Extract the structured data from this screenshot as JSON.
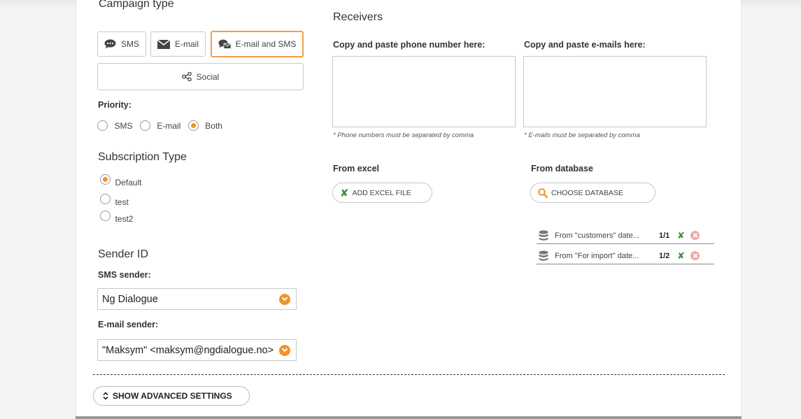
{
  "campaign": {
    "heading": "Campaign type",
    "types": {
      "sms": "SMS",
      "email": "E-mail",
      "email_sms": "E-mail and SMS",
      "social": "Social"
    }
  },
  "priority": {
    "label": "Priority:",
    "options": [
      "SMS",
      "E-mail",
      "Both"
    ],
    "selected": "Both"
  },
  "subscription": {
    "heading": "Subscription Type",
    "options": [
      "Default",
      "test",
      "test2"
    ],
    "selected": "Default"
  },
  "sender": {
    "heading": "Sender ID",
    "sms_label": "SMS sender:",
    "sms_value": "Ng Dialogue",
    "email_label": "E-mail sender:",
    "email_value": "\"Maksym\" <maksym@ngdialogue.no>"
  },
  "receivers": {
    "heading": "Receivers",
    "phone_label": "Copy and paste phone number here:",
    "phone_note": "* Phone numbers must be separated by comma",
    "email_label": "Copy and paste e-mails here:",
    "email_note": "* E-mails must be separated by comma",
    "excel_label": "From excel",
    "excel_button": "ADD EXCEL FILE",
    "db_label": "From database",
    "db_button": "CHOOSE DATABASE",
    "databases": [
      {
        "name": "From \"customers\" date...",
        "count": "1/1"
      },
      {
        "name": "From \"For import\" date...",
        "count": "1/2"
      }
    ]
  },
  "advanced_button": "SHOW ADVANCED SETTINGS",
  "colors": {
    "accent": "#f0932b",
    "border_active": "#f0a04b",
    "excel_green": "#3a8c3a"
  }
}
